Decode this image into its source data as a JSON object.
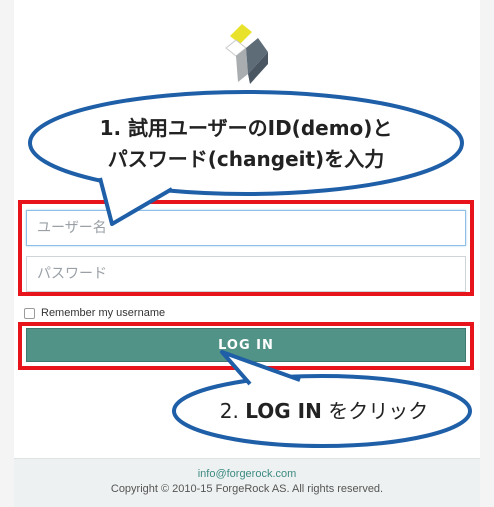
{
  "colors": {
    "annotation_red": "#e8141b",
    "bubble_border": "#1f5fa8",
    "button_green": "#519387",
    "link_teal": "#3d8b82"
  },
  "logo": {
    "icon": "forgerock-logo-icon"
  },
  "form": {
    "username_placeholder": "ユーザー名",
    "password_placeholder": "パスワード",
    "remember_label": "Remember my username",
    "login_label": "LOG IN"
  },
  "annotations": {
    "bubble1_line1": "1. 試用ユーザーのID(demo)と",
    "bubble1_line2": "パスワード(changeit)を入力",
    "bubble2_num": "2. ",
    "bubble2_strong": "LOG IN",
    "bubble2_rest": " をクリック"
  },
  "footer": {
    "email": "info@forgerock.com",
    "copyright": "Copyright © 2010-15 ForgeRock AS. All rights reserved."
  }
}
